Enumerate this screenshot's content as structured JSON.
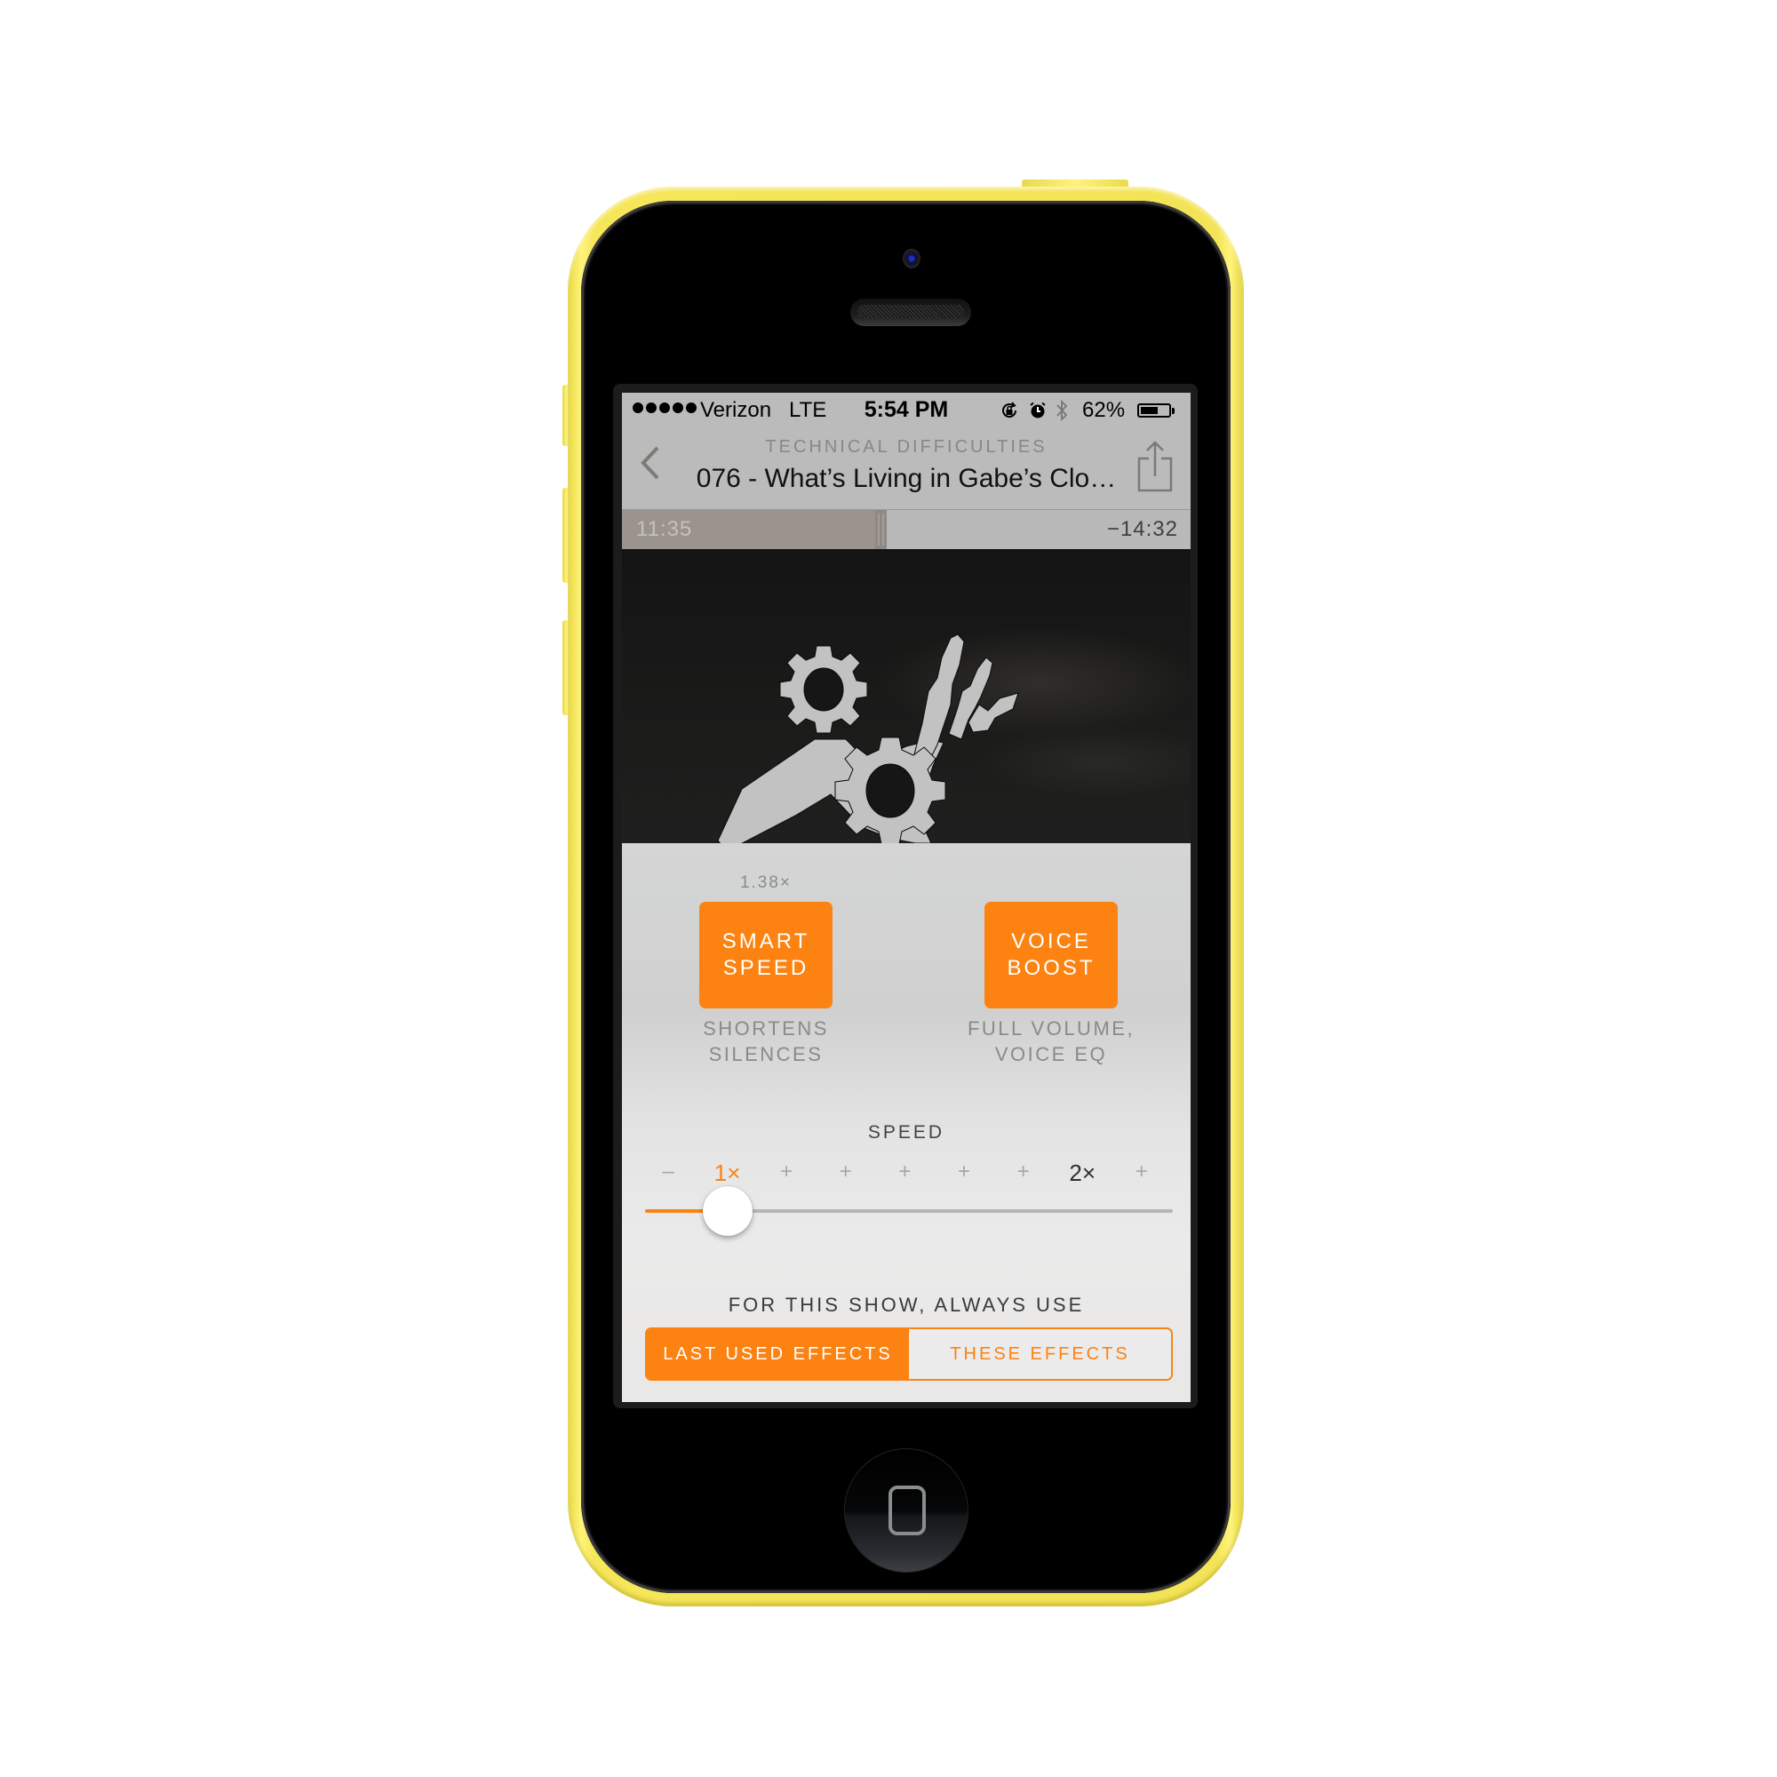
{
  "device": {
    "model": "iPhone 5c",
    "color": "#f5e65a"
  },
  "status_bar": {
    "signal_bars": 5,
    "carrier": "Verizon",
    "network": "LTE",
    "time": "5:54 PM",
    "icons": [
      "rotation-lock-icon",
      "alarm-icon",
      "bluetooth-icon"
    ],
    "battery_percent": "62%",
    "battery_level": 0.62
  },
  "header": {
    "back_icon": "chevron-left-icon",
    "show_title": "TECHNICAL DIFFICULTIES",
    "episode_title": "076 - What’s Living in Gabe’s Clo…",
    "share_icon": "share-icon"
  },
  "playback": {
    "elapsed": "11:35",
    "remaining": "−14:32",
    "progress": 0.465
  },
  "artwork": {
    "description": "Technical Difficulties podcast logo: gears and broken robot arm on dark cloudy background"
  },
  "effects": {
    "smart_speed": {
      "multiplier": "1.38×",
      "label": "SMART\nSPEED",
      "description": "SHORTENS\nSILENCES",
      "enabled": true
    },
    "voice_boost": {
      "label": "VOICE\nBOOST",
      "description": "FULL VOLUME,\nVOICE EQ",
      "enabled": true
    },
    "accent_color": "#fc8212"
  },
  "speed": {
    "label": "SPEED",
    "ticks": [
      "–",
      "1×",
      "+",
      "+",
      "+",
      "+",
      "+",
      "2×",
      "+"
    ],
    "active_tick_index": 1,
    "major_tick_indices": [
      1,
      7
    ],
    "value": "1×",
    "slider_fraction": 0.157
  },
  "always_use": {
    "label": "FOR THIS SHOW, ALWAYS USE",
    "options": [
      "LAST USED EFFECTS",
      "THESE EFFECTS"
    ],
    "selected_index": 0
  }
}
